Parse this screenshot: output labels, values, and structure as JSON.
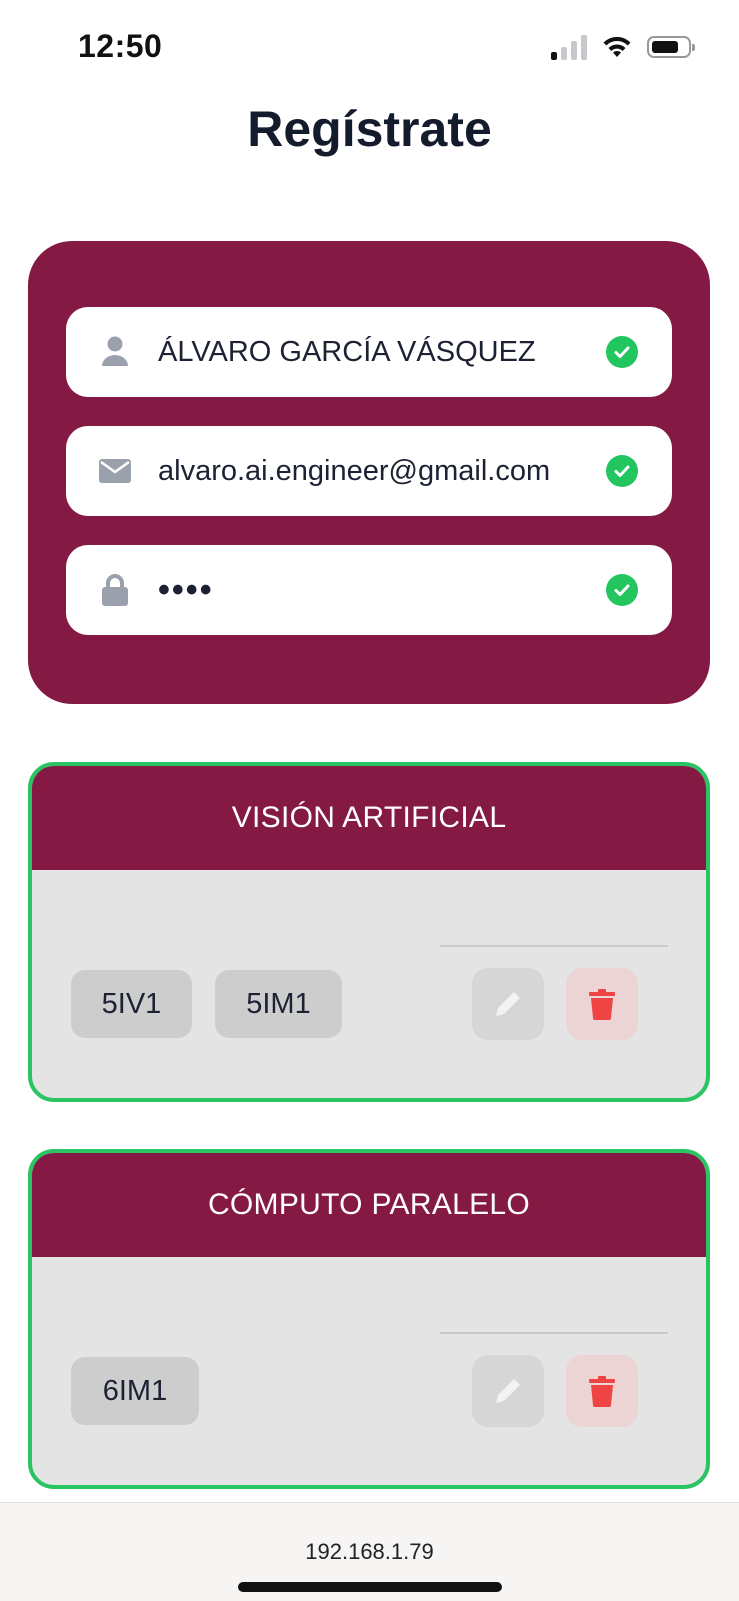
{
  "status": {
    "time": "12:50",
    "icons": [
      "cellular-signal-icon",
      "wifi-icon",
      "battery-icon"
    ]
  },
  "title": "Regístrate",
  "form": {
    "background": "#841943",
    "fields": [
      {
        "icon": "user-icon",
        "value": "ÁLVARO GARCÍA VÁSQUEZ",
        "valid": true
      },
      {
        "icon": "envelope-icon",
        "value": "alvaro.ai.engineer@gmail.com",
        "valid": true
      },
      {
        "icon": "lock-icon",
        "value": "••••",
        "valid": true
      }
    ]
  },
  "courses": [
    {
      "name": "VISIÓN ARTIFICIAL",
      "groups": [
        "5IV1",
        "5IM1"
      ]
    },
    {
      "name": "CÓMPUTO PARALELO",
      "groups": [
        "6IM1"
      ]
    }
  ],
  "colors": {
    "accent": "#841943",
    "success": "#22c55e",
    "card_border": "#2bc462",
    "delete": "#ef4444"
  },
  "browser": {
    "url": "192.168.1.79"
  }
}
